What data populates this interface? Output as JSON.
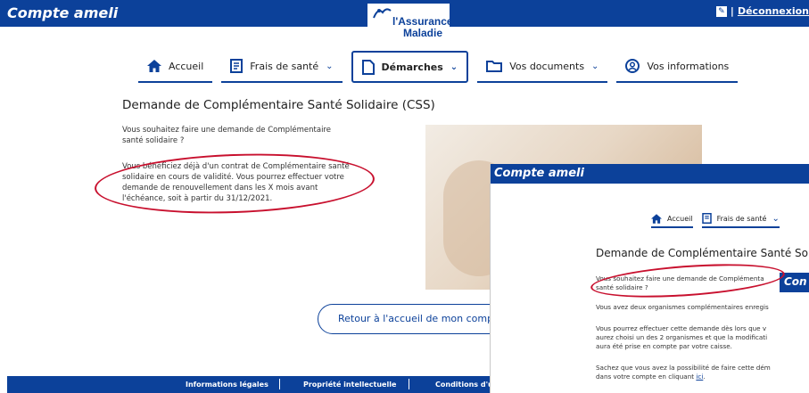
{
  "header": {
    "brand": "Compte ameli",
    "logo_line1": "l'Assurance",
    "logo_line2": "Maladie",
    "user_icon": "user-badge-icon",
    "separator": "|",
    "logout_label": "Déconnexion"
  },
  "nav": {
    "items": [
      {
        "label": "Accueil",
        "icon": "home-icon"
      },
      {
        "label": "Frais de santé",
        "icon": "receipt-icon"
      },
      {
        "label": "Démarches",
        "icon": "document-icon"
      },
      {
        "label": "Vos documents",
        "icon": "folder-icon"
      },
      {
        "label": "Vos informations",
        "icon": "user-circle-icon"
      }
    ]
  },
  "main": {
    "title": "Demande de Complémentaire Santé Solidaire (CSS)",
    "paragraph1": "Vous souhaitez faire une demande de Complémentaire santé solidaire ?",
    "paragraph2": "Vous bénéficiez déjà d'un contrat de Complémentaire santé solidaire en cours de validité. Vous pourrez effectuer votre demande de renouvellement dans les X mois avant l'échéance, soit à partir du 31/12/2021.",
    "back_button": "Retour à l'accueil de mon compte"
  },
  "footer": {
    "links": [
      "Informations légales",
      "Propriété intellectuelle",
      "Conditions d'ut"
    ]
  },
  "overlay": {
    "brand": "Compte ameli",
    "nav": [
      "Accueil",
      "Frais de santé"
    ],
    "title": "Demande de Complémentaire Santé Solid",
    "text1": "Vous souhaitez faire une demande de Complémenta",
    "text1b": "santé solidaire ?",
    "mini_brand": "Con",
    "text2": "Vous avez deux organismes complémentaires enregis",
    "text3a": "Vous pourrez effectuer cette demande dès lors que v",
    "text3b": "aurez choisi un des 2 organismes et que la modificati",
    "text3c": "aura été prise en compte par votre caisse.",
    "text4a": "Sachez que vous avez la possibilité de faire cette dém",
    "text4b": "dans votre compte en cliquant",
    "link": "ici"
  },
  "colors": {
    "brand_blue": "#0c419a",
    "highlight_red": "#c8102e"
  }
}
